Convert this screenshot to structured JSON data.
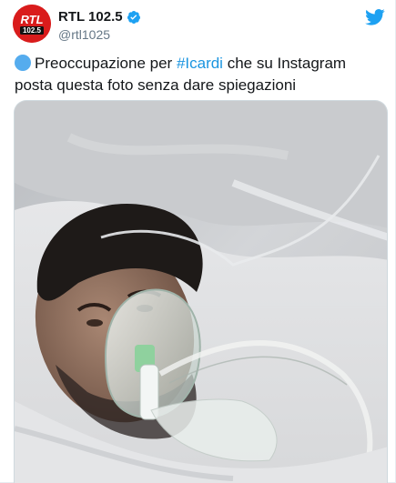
{
  "tweet": {
    "display_name": "RTL 102.5",
    "handle": "@rtl1025",
    "avatar_text": "RTL",
    "avatar_subtext": "102.5",
    "text_before": "Preoccupazione per ",
    "hashtag": "#Icardi",
    "text_after": " che su Instagram posta questa foto senza dare spiegazioni",
    "verified": true
  },
  "icons": {
    "verified": "verified-badge-icon",
    "brand": "twitter-bird-icon",
    "emoji": "blue-circle-emoji-icon"
  },
  "colors": {
    "brand_blue": "#1da1f2",
    "hashtag": "#1b95e0",
    "avatar_red": "#d91c1c"
  }
}
